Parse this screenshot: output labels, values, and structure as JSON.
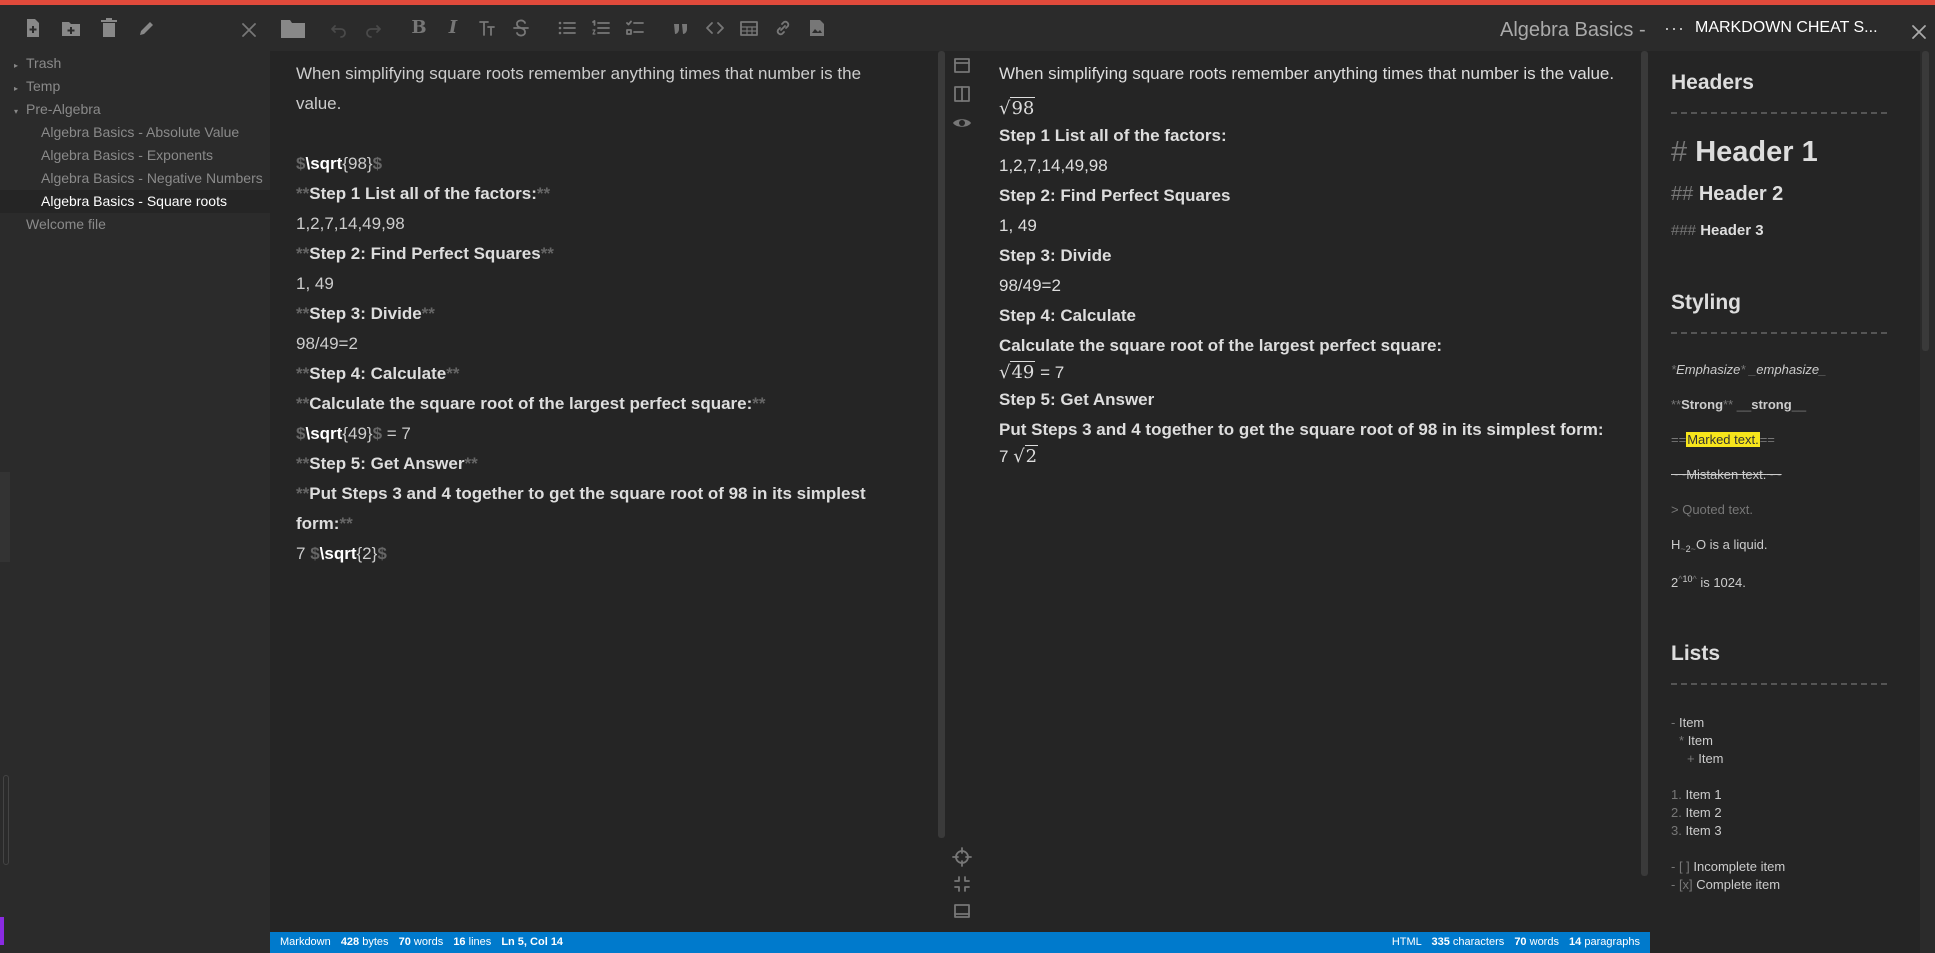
{
  "window": {
    "title": "Algebra Basics - Square roots",
    "accent": "#007acc",
    "topbar_color": "#e04a3b"
  },
  "explorer": {
    "toolbar": {
      "new_file": "file-plus-icon",
      "new_folder": "folder-plus-icon",
      "delete": "trash-icon",
      "rename": "pencil-icon",
      "close": "close-icon"
    },
    "tree": [
      {
        "label": "Trash",
        "type": "folder",
        "expanded": false
      },
      {
        "label": "Temp",
        "type": "folder",
        "expanded": false
      },
      {
        "label": "Pre-Algebra",
        "type": "folder",
        "expanded": true
      },
      {
        "label": "Algebra Basics - Absolute Value",
        "type": "file"
      },
      {
        "label": "Algebra Basics - Exponents",
        "type": "file"
      },
      {
        "label": "Algebra Basics - Negative Numbers",
        "type": "file"
      },
      {
        "label": "Algebra Basics - Square roots",
        "type": "file",
        "selected": true
      },
      {
        "label": "Welcome file",
        "type": "file"
      }
    ]
  },
  "editor": {
    "intro": "When simplifying square roots remember anything times that number is the value.",
    "sqrt_cmd": "\\sqrt",
    "dollar": "$",
    "stars": "**",
    "arg98": "{98}",
    "arg49": "{49}",
    "arg2": "{2}",
    "eq7": " = 7",
    "seven": "7 ",
    "step1": "Step 1 List all of the factors:",
    "factors": "1,2,7,14,49,98",
    "step2": "Step 2: Find Perfect Squares",
    "squares": "1, 49",
    "step3": "Step 3: Divide",
    "divide": "98/49=2",
    "step4": "Step 4: Calculate",
    "calc": "Calculate the square root of the largest perfect square:",
    "step5": "Step 5: Get Answer",
    "put_a": "Put Steps 3 and 4 together to get the square root of 98 in its simplest",
    "put_b": "form:",
    "put_full": "Put Steps 3 and 4 together to get the square root of 98 in its simplest form:"
  },
  "preview": {
    "radical": "√",
    "n98": "98",
    "n49": "49",
    "n2": "2",
    "eq7": " = 7",
    "seven": "7 "
  },
  "status_left": {
    "mode": "Markdown",
    "bytes": "428",
    "bytes_label": "bytes",
    "words": "70",
    "words_label": "words",
    "lines": "16",
    "lines_label": "lines",
    "position": "Ln 5, Col 14"
  },
  "status_right": {
    "mode": "HTML",
    "chars": "335",
    "chars_label": "characters",
    "words": "70",
    "words_label": "words",
    "paras": "14",
    "paras_label": "paragraphs"
  },
  "cheat": {
    "menu": "···",
    "title": "MARKDOWN CHEAT S...",
    "headers": "Headers",
    "h1_mk": "#",
    "h1": "Header 1",
    "h2_mk": "##",
    "h2": "Header 2",
    "h3_mk": "###",
    "h3": "Header 3",
    "styling": "Styling",
    "em_mk1": "*",
    "em1": "Emphasize",
    "em_mk2": "_",
    "em2": "emphasize",
    "strong_mk1": "**",
    "strong1": "Strong",
    "strong_mk2": "__",
    "strong2": "strong",
    "mark_mk": "==",
    "mark": "Marked text.",
    "del_mk": "~~",
    "del": "Mistaken text.",
    "quote": "> Quoted text.",
    "h": "H",
    "sub_mk": "~",
    "two": "2",
    "o_liquid": "O is a liquid.",
    "sup_mk": "^",
    "ten": "10",
    "is1024": " is 1024.",
    "lists": "Lists",
    "bullets": [
      {
        "mk": "-",
        "text": "Item"
      },
      {
        "mk": "*",
        "text": "Item"
      },
      {
        "mk": "+",
        "text": "Item"
      }
    ],
    "numbered": [
      {
        "mk": "1.",
        "text": "Item 1"
      },
      {
        "mk": "2.",
        "text": "Item 2"
      },
      {
        "mk": "3.",
        "text": "Item 3"
      }
    ],
    "todo_incomplete_mk": "- [ ]",
    "todo_incomplete": "Incomplete item",
    "todo_complete_mk": "- [x]",
    "todo_complete": "Complete item",
    "mark_color": "#f7e51c"
  }
}
